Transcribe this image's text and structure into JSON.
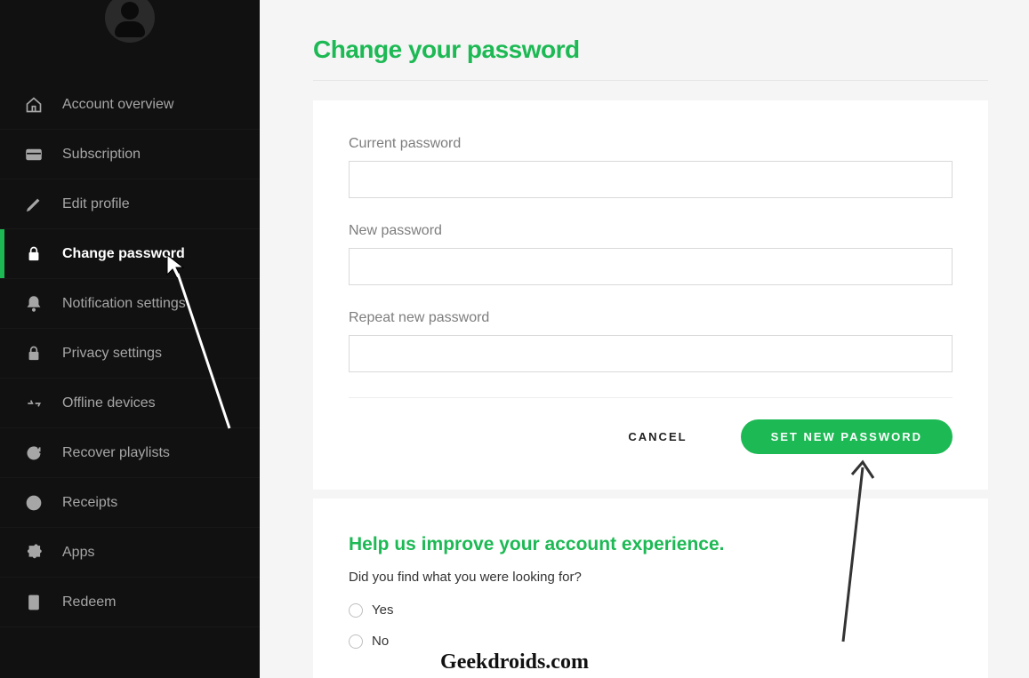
{
  "colors": {
    "accent": "#1db954"
  },
  "sidebar": {
    "items": [
      {
        "id": "account-overview",
        "label": "Account overview",
        "icon": "home-icon"
      },
      {
        "id": "subscription",
        "label": "Subscription",
        "icon": "card-icon"
      },
      {
        "id": "edit-profile",
        "label": "Edit profile",
        "icon": "pencil-icon"
      },
      {
        "id": "change-password",
        "label": "Change password",
        "icon": "lock-icon",
        "active": true
      },
      {
        "id": "notification-settings",
        "label": "Notification settings",
        "icon": "bell-icon"
      },
      {
        "id": "privacy-settings",
        "label": "Privacy settings",
        "icon": "lock-icon"
      },
      {
        "id": "offline-devices",
        "label": "Offline devices",
        "icon": "devices-icon"
      },
      {
        "id": "recover-playlists",
        "label": "Recover playlists",
        "icon": "refresh-icon"
      },
      {
        "id": "receipts",
        "label": "Receipts",
        "icon": "clock-icon"
      },
      {
        "id": "apps",
        "label": "Apps",
        "icon": "puzzle-icon"
      },
      {
        "id": "redeem",
        "label": "Redeem",
        "icon": "redeem-icon"
      }
    ]
  },
  "page": {
    "title": "Change your password"
  },
  "form": {
    "current_label": "Current password",
    "new_label": "New password",
    "repeat_label": "Repeat new password",
    "current_value": "",
    "new_value": "",
    "repeat_value": "",
    "cancel_label": "CANCEL",
    "submit_label": "SET NEW PASSWORD"
  },
  "feedback": {
    "title": "Help us improve your account experience.",
    "question": "Did you find what you were looking for?",
    "options": [
      "Yes",
      "No"
    ]
  },
  "watermark": "Geekdroids.com"
}
